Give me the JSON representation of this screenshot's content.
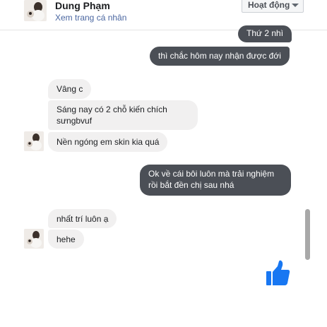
{
  "header": {
    "contact_name": "Dung Phạm",
    "profile_link": "Xem trang cá nhân",
    "activity_button": "Hoạt động"
  },
  "messages": [
    {
      "direction": "out",
      "text": "Thứ 2 nhì"
    },
    {
      "direction": "out",
      "text": "thì chắc hôm nay nhận được đới"
    },
    {
      "direction": "in",
      "text": "Vâng c"
    },
    {
      "direction": "in",
      "lines": [
        "Sáng nay có 2 chỗ kiến chích",
        "sưngbvuf"
      ]
    },
    {
      "direction": "in",
      "text": "Nền ngóng em skin kia quá"
    },
    {
      "direction": "out",
      "lines": [
        "Ok về cái bôi luôn mà trải nghiệm",
        "rồi bắt đền chị sau  nhá"
      ]
    },
    {
      "direction": "in",
      "text": "nhất trí luôn ạ"
    },
    {
      "direction": "in",
      "text": "hehe"
    }
  ],
  "colors": {
    "outgoing_bubble": "#4b4f56",
    "incoming_bubble": "#f1f0f0",
    "like_icon": "#1877f2",
    "link": "#4b67a1"
  },
  "icons": {
    "like": "thumbs-up-icon",
    "dropdown": "caret-down-icon"
  }
}
